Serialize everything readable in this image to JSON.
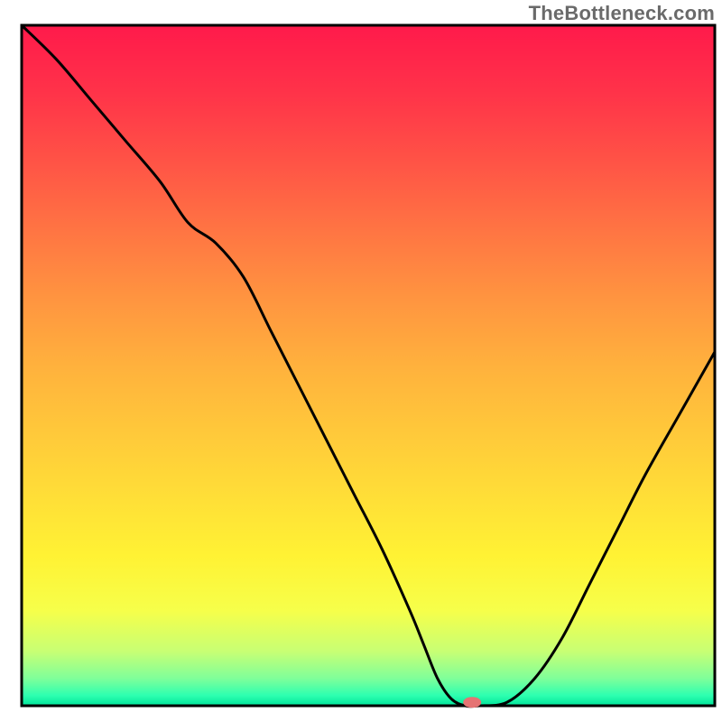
{
  "watermark": "TheBottleneck.com",
  "chart_data": {
    "type": "line",
    "title": "",
    "xlabel": "",
    "ylabel": "",
    "xlim": [
      0,
      100
    ],
    "ylim": [
      0,
      100
    ],
    "grid": false,
    "legend": false,
    "background_gradient": {
      "stops": [
        {
          "offset": 0.0,
          "color": "#ff1a4b"
        },
        {
          "offset": 0.1,
          "color": "#ff3349"
        },
        {
          "offset": 0.2,
          "color": "#ff5346"
        },
        {
          "offset": 0.3,
          "color": "#ff7443"
        },
        {
          "offset": 0.4,
          "color": "#ff9440"
        },
        {
          "offset": 0.5,
          "color": "#ffb13d"
        },
        {
          "offset": 0.6,
          "color": "#ffc93a"
        },
        {
          "offset": 0.7,
          "color": "#ffe037"
        },
        {
          "offset": 0.78,
          "color": "#fff234"
        },
        {
          "offset": 0.86,
          "color": "#f6ff4a"
        },
        {
          "offset": 0.92,
          "color": "#c8ff74"
        },
        {
          "offset": 0.96,
          "color": "#7fff9a"
        },
        {
          "offset": 0.985,
          "color": "#2dffb0"
        },
        {
          "offset": 1.0,
          "color": "#00e49a"
        }
      ]
    },
    "series": [
      {
        "name": "bottleneck-curve",
        "color": "#000000",
        "x": [
          0,
          5,
          10,
          15,
          20,
          24,
          28,
          32,
          36,
          40,
          44,
          48,
          52,
          56,
          58,
          60,
          62,
          64,
          66,
          70,
          74,
          78,
          82,
          86,
          90,
          95,
          100
        ],
        "y": [
          100,
          95,
          89,
          83,
          77,
          71,
          68,
          63,
          55,
          47,
          39,
          31,
          23,
          14,
          9,
          4,
          1,
          0,
          0,
          0.5,
          4,
          10,
          18,
          26,
          34,
          43,
          52
        ]
      }
    ],
    "marker": {
      "name": "optimal-point",
      "x": 65,
      "y": 0.5,
      "color": "#e57373",
      "rx": 10,
      "ry": 6
    }
  }
}
